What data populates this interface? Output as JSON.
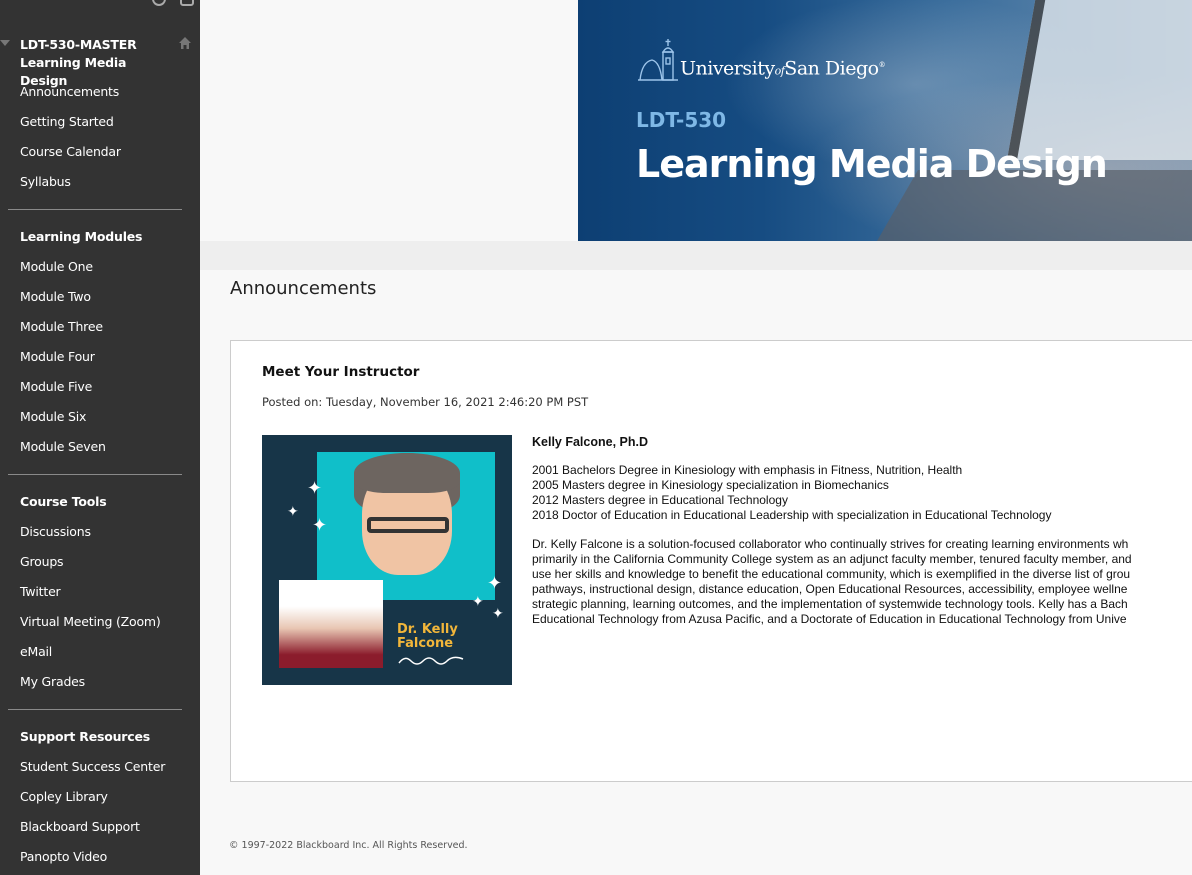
{
  "sidebar": {
    "course_code": "LDT-530-MASTER",
    "course_name": "Learning Media Design",
    "sections": [
      {
        "heading": null,
        "items": [
          "Announcements",
          "Getting Started",
          "Course Calendar",
          "Syllabus"
        ]
      },
      {
        "heading": "Learning Modules",
        "items": [
          "Module One",
          "Module Two",
          "Module Three",
          "Module Four",
          "Module Five",
          "Module Six",
          "Module Seven"
        ]
      },
      {
        "heading": "Course Tools",
        "items": [
          "Discussions",
          "Groups",
          "Twitter",
          "Virtual Meeting (Zoom)",
          "eMail",
          "My Grades"
        ]
      },
      {
        "heading": "Support Resources",
        "items": [
          "Student Success Center",
          "Copley Library",
          "Blackboard Support",
          "Panopto Video"
        ]
      }
    ]
  },
  "banner": {
    "university_pre": "University",
    "university_of": "of",
    "university_post": "San Diego",
    "course_code": "LDT-530",
    "course_title": "Learning Media Design",
    "colors": {
      "primary": "#0d3f73",
      "code": "#7fb8e6"
    }
  },
  "page": {
    "title": "Announcements"
  },
  "announcement": {
    "title": "Meet Your Instructor",
    "posted": "Posted on: Tuesday, November 16, 2021 2:46:20 PM PST",
    "image_caption_line1": "Dr. Kelly",
    "image_caption_line2": "Falcone",
    "instructor_name": "Kelly Falcone, Ph.D",
    "degrees": [
      "2001 Bachelors Degree in Kinesiology with emphasis in Fitness, Nutrition, Health",
      "2005 Masters degree in Kinesiology specialization in Biomechanics",
      "2012 Masters degree in Educational Technology",
      "2018 Doctor of Education in Educational Leadership with specialization in Educational Technology"
    ],
    "bio_lines": [
      "Dr. Kelly Falcone is a solution-focused collaborator who continually strives for creating learning environments wh",
      "primarily in the California Community College system as an adjunct faculty member, tenured faculty member, and",
      "use her skills and knowledge to benefit the educational community, which is exemplified in the diverse list of grou",
      "pathways, instructional design, distance education, Open Educational Resources, accessibility, employee wellne",
      "strategic planning, learning outcomes, and the implementation of systemwide technology tools. Kelly has a Bach",
      "Educational Technology from Azusa Pacific, and a Doctorate of Education in Educational Technology from Unive"
    ]
  },
  "footer": {
    "copyright": "© 1997-2022 Blackboard Inc. All Rights Reserved."
  }
}
